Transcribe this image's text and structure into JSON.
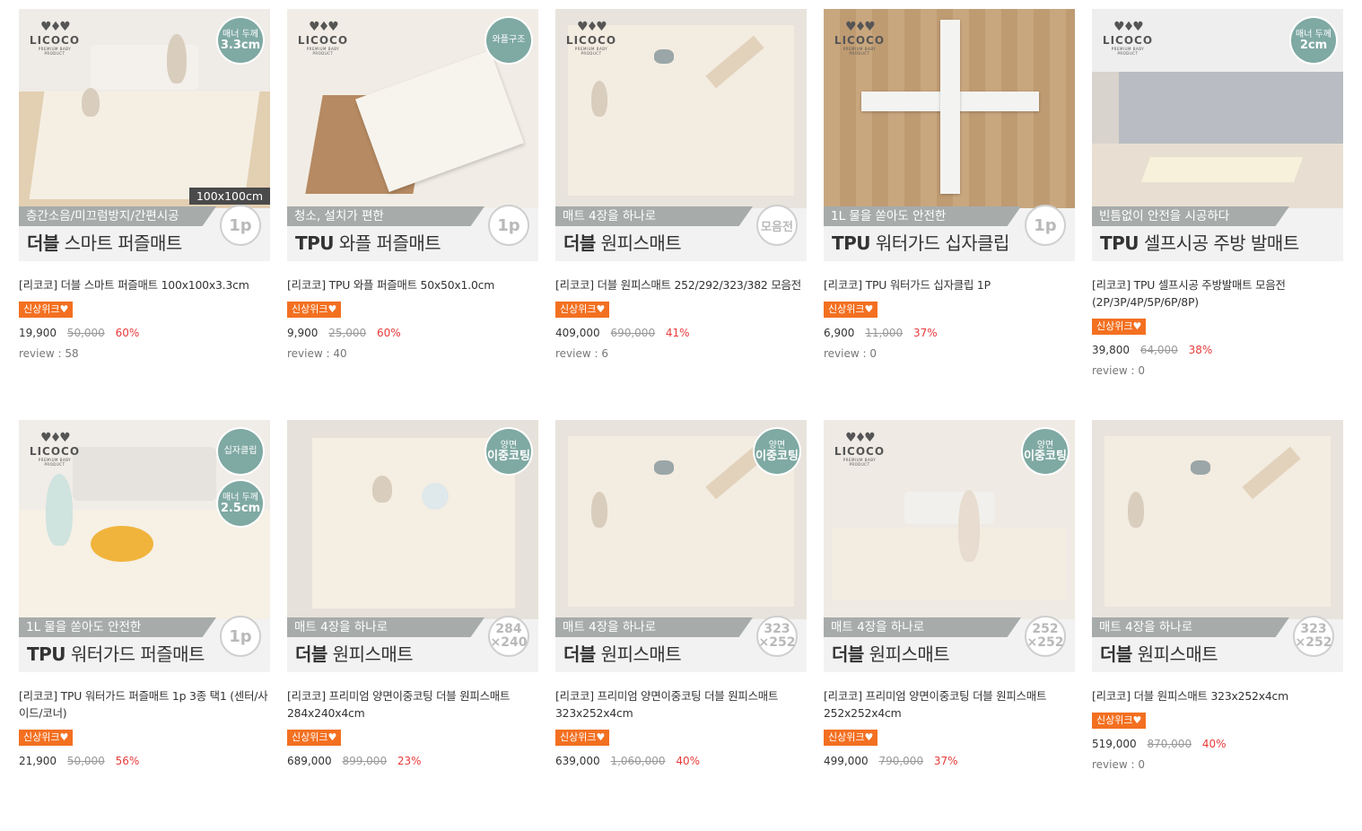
{
  "products": [
    {
      "sub": "층간소음/미끄럼방지/간편시공",
      "main_bold": "더블",
      "main_rest": " 스마트 퍼즐매트",
      "circle": "1p",
      "badge_top": "매너 두께",
      "badge_val": "3.3cm",
      "size_tag": "100x100cm",
      "logo": true,
      "title": "[리코코] 더블 스마트 퍼즐매트 100x100x3.3cm",
      "tag": "신상위크♥",
      "price": "19,900",
      "orig": "50,000",
      "pct": "60%",
      "review": "review : 58",
      "scene": "living"
    },
    {
      "sub": "청소, 설치가 편한",
      "main_bold": "TPU",
      "main_rest": " 와플 퍼즐매트",
      "circle": "1p",
      "badge_top": "와플구조",
      "badge_val": "",
      "logo": true,
      "title": "[리코코] TPU 와플 퍼즐매트 50x50x1.0cm",
      "tag": "신상위크♥",
      "price": "9,900",
      "orig": "25,000",
      "pct": "60%",
      "review": "review : 40",
      "scene": "tiles"
    },
    {
      "sub": "매트 4장을 하나로",
      "main_bold": "더블",
      "main_rest": " 원피스매트",
      "circle": "모음전",
      "logo": true,
      "title": "[리코코] 더블 원피스매트 252/292/323/382 모음전",
      "tag": "신상위크♥",
      "price": "409,000",
      "orig": "690,000",
      "pct": "41%",
      "review": "review : 6",
      "scene": "topview"
    },
    {
      "sub": "1L 물을 쏟아도 안전한",
      "main_bold": "TPU",
      "main_rest": " 워터가드 십자클립",
      "circle": "1p",
      "logo": true,
      "title": "[리코코] TPU 워터가드 십자클립 1P",
      "tag": "신상위크♥",
      "price": "6,900",
      "orig": "11,000",
      "pct": "37%",
      "review": "review : 0",
      "scene": "wood"
    },
    {
      "sub": "빈틈없이 안전을 시공하다",
      "main_bold": "TPU",
      "main_rest": " 셀프시공 주방 발매트",
      "circle": "",
      "badge_top": "매너 두께",
      "badge_val": "2cm",
      "logo": true,
      "title": "[리코코] TPU 셀프시공 주방발매트 모음전 (2P/3P/4P/5P/6P/8P)",
      "tag": "신상위크♥",
      "price": "39,800",
      "orig": "64,000",
      "pct": "38%",
      "review": "review : 0",
      "scene": "kitchen"
    },
    {
      "sub": "1L 물을 쏟아도 안전한",
      "main_bold": "TPU",
      "main_rest": " 워터가드 퍼즐매트",
      "circle": "1p",
      "badge_top": "십자클립",
      "badge_val": "",
      "badge2_top": "매너 두께",
      "badge2_val": "2.5cm",
      "logo": true,
      "title": "[리코코] TPU 워터가드 퍼즐매트 1p 3종 택1 (센터/사이드/코너)",
      "tag": "신상위크♥",
      "price": "21,900",
      "orig": "50,000",
      "pct": "56%",
      "review": "",
      "scene": "spill"
    },
    {
      "sub": "매트 4장을 하나로",
      "main_bold": "더블",
      "main_rest": " 원피스매트",
      "circle": "284×240",
      "badge_top": "양면",
      "badge_val": "이중코팅",
      "logo": false,
      "title": "[리코코] 프리미엄 양면이중코팅 더블 원피스매트 284x240x4cm",
      "tag": "신상위크♥",
      "price": "689,000",
      "orig": "899,000",
      "pct": "23%",
      "review": "",
      "scene": "topview2"
    },
    {
      "sub": "매트 4장을 하나로",
      "main_bold": "더블",
      "main_rest": " 원피스매트",
      "circle": "323×252",
      "badge_top": "양면",
      "badge_val": "이중코팅",
      "logo": false,
      "title": "[리코코] 프리미엄 양면이중코팅 더블 원피스매트 323x252x4cm",
      "tag": "신상위크♥",
      "price": "639,000",
      "orig": "1,060,000",
      "pct": "40%",
      "review": "",
      "scene": "topview"
    },
    {
      "sub": "매트 4장을 하나로",
      "main_bold": "더블",
      "main_rest": " 원피스매트",
      "circle": "252×252",
      "badge_top": "양면",
      "badge_val": "이중코팅",
      "logo": true,
      "title": "[리코코] 프리미엄 양면이중코팅 더블 원피스매트 252x252x4cm",
      "tag": "신상위크♥",
      "price": "499,000",
      "orig": "790,000",
      "pct": "37%",
      "review": "",
      "scene": "room"
    },
    {
      "sub": "매트 4장을 하나로",
      "main_bold": "더블",
      "main_rest": " 원피스매트",
      "circle": "323×252",
      "logo": false,
      "title": "[리코코] 더블 원피스매트 323x252x4cm",
      "tag": "신상위크♥",
      "price": "519,000",
      "orig": "870,000",
      "pct": "40%",
      "review": "review : 0",
      "scene": "topview"
    }
  ],
  "logo_text": {
    "word": "LICOCO",
    "tagline": "PREMIUM BABY PRODUCT"
  }
}
